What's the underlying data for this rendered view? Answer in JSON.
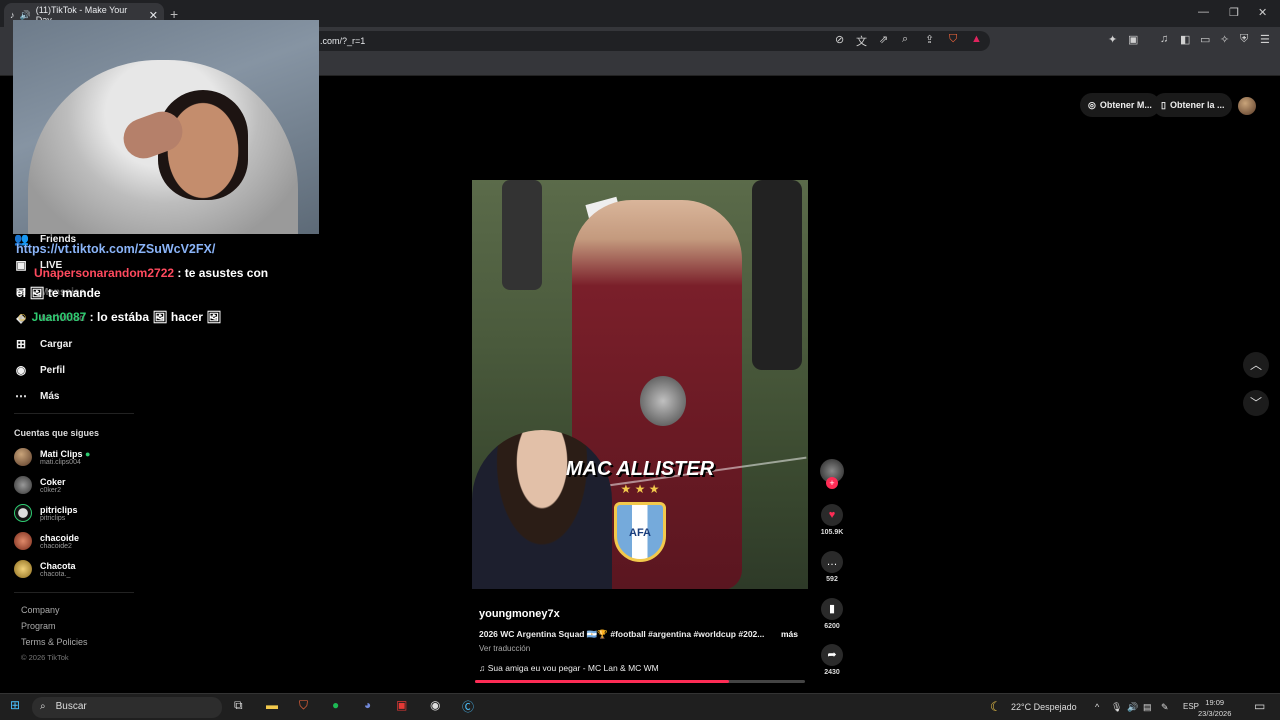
{
  "browser": {
    "tab_title": "(11)TikTok - Make Your Day",
    "url": ".com/?_r=1",
    "new_tab": "+",
    "tab_close": "✕"
  },
  "header": {
    "get_coins": "Obtener M...",
    "get_app": "Obtener la ..."
  },
  "sidebar": {
    "items": [
      {
        "label": "Friends",
        "icon": "friends-icon"
      },
      {
        "label": "LIVE",
        "icon": "live-icon"
      },
      {
        "label": "Mensajes",
        "icon": "messages-icon"
      },
      {
        "label": "Actividad",
        "icon": "activity-icon"
      },
      {
        "label": "Cargar",
        "icon": "upload-icon"
      },
      {
        "label": "Perfil",
        "icon": "profile-icon"
      },
      {
        "label": "Más",
        "icon": "more-icon"
      }
    ],
    "following_title": "Cuentas que sigues",
    "following": [
      {
        "name": "Mati Clips",
        "handle": "mati.clips004"
      },
      {
        "name": "Coker",
        "handle": "c0ker2"
      },
      {
        "name": "pitriclips",
        "handle": "pitriclips"
      },
      {
        "name": "chacoide",
        "handle": "chacoide2"
      },
      {
        "name": "Chacota",
        "handle": "chacota._"
      }
    ],
    "footer": [
      "Company",
      "Program",
      "Terms & Policies",
      "© 2026 TikTok"
    ]
  },
  "video": {
    "overlay_name": "MAC ALLISTER",
    "stars": "★ ★ ★",
    "crest_text": "AFA",
    "username": "youngmoney7x",
    "description": "2026 WC Argentina Squad 🇦🇷🏆 #football #argentina #worldcup #202...",
    "more": "más",
    "translate": "Ver traducción",
    "music": "♫  Sua amiga eu vou pegar - MC Lan & MC WM",
    "progress": 0.77
  },
  "actions": {
    "likes": "105.9K",
    "comments": "592",
    "saves": "6200",
    "shares": "2430"
  },
  "chat": {
    "link": "https://vt.tiktok.com/ZSuWcV2FX/",
    "msg1_user": "Unapersonarandom2722",
    "msg1_text": ": te asustes con",
    "msg1_cont": "el 🖼 te mande",
    "msg2_user": "Juan0087",
    "msg2_text": ": lo estába 🖼 hacer 🖼"
  },
  "taskbar": {
    "search": "Buscar",
    "weather": "22°C  Despejado",
    "lang": "ESP",
    "time": "19:09",
    "date": "23/3/2026"
  },
  "colors": {
    "accent": "#fe2c55",
    "link": "#8ab4f8"
  }
}
